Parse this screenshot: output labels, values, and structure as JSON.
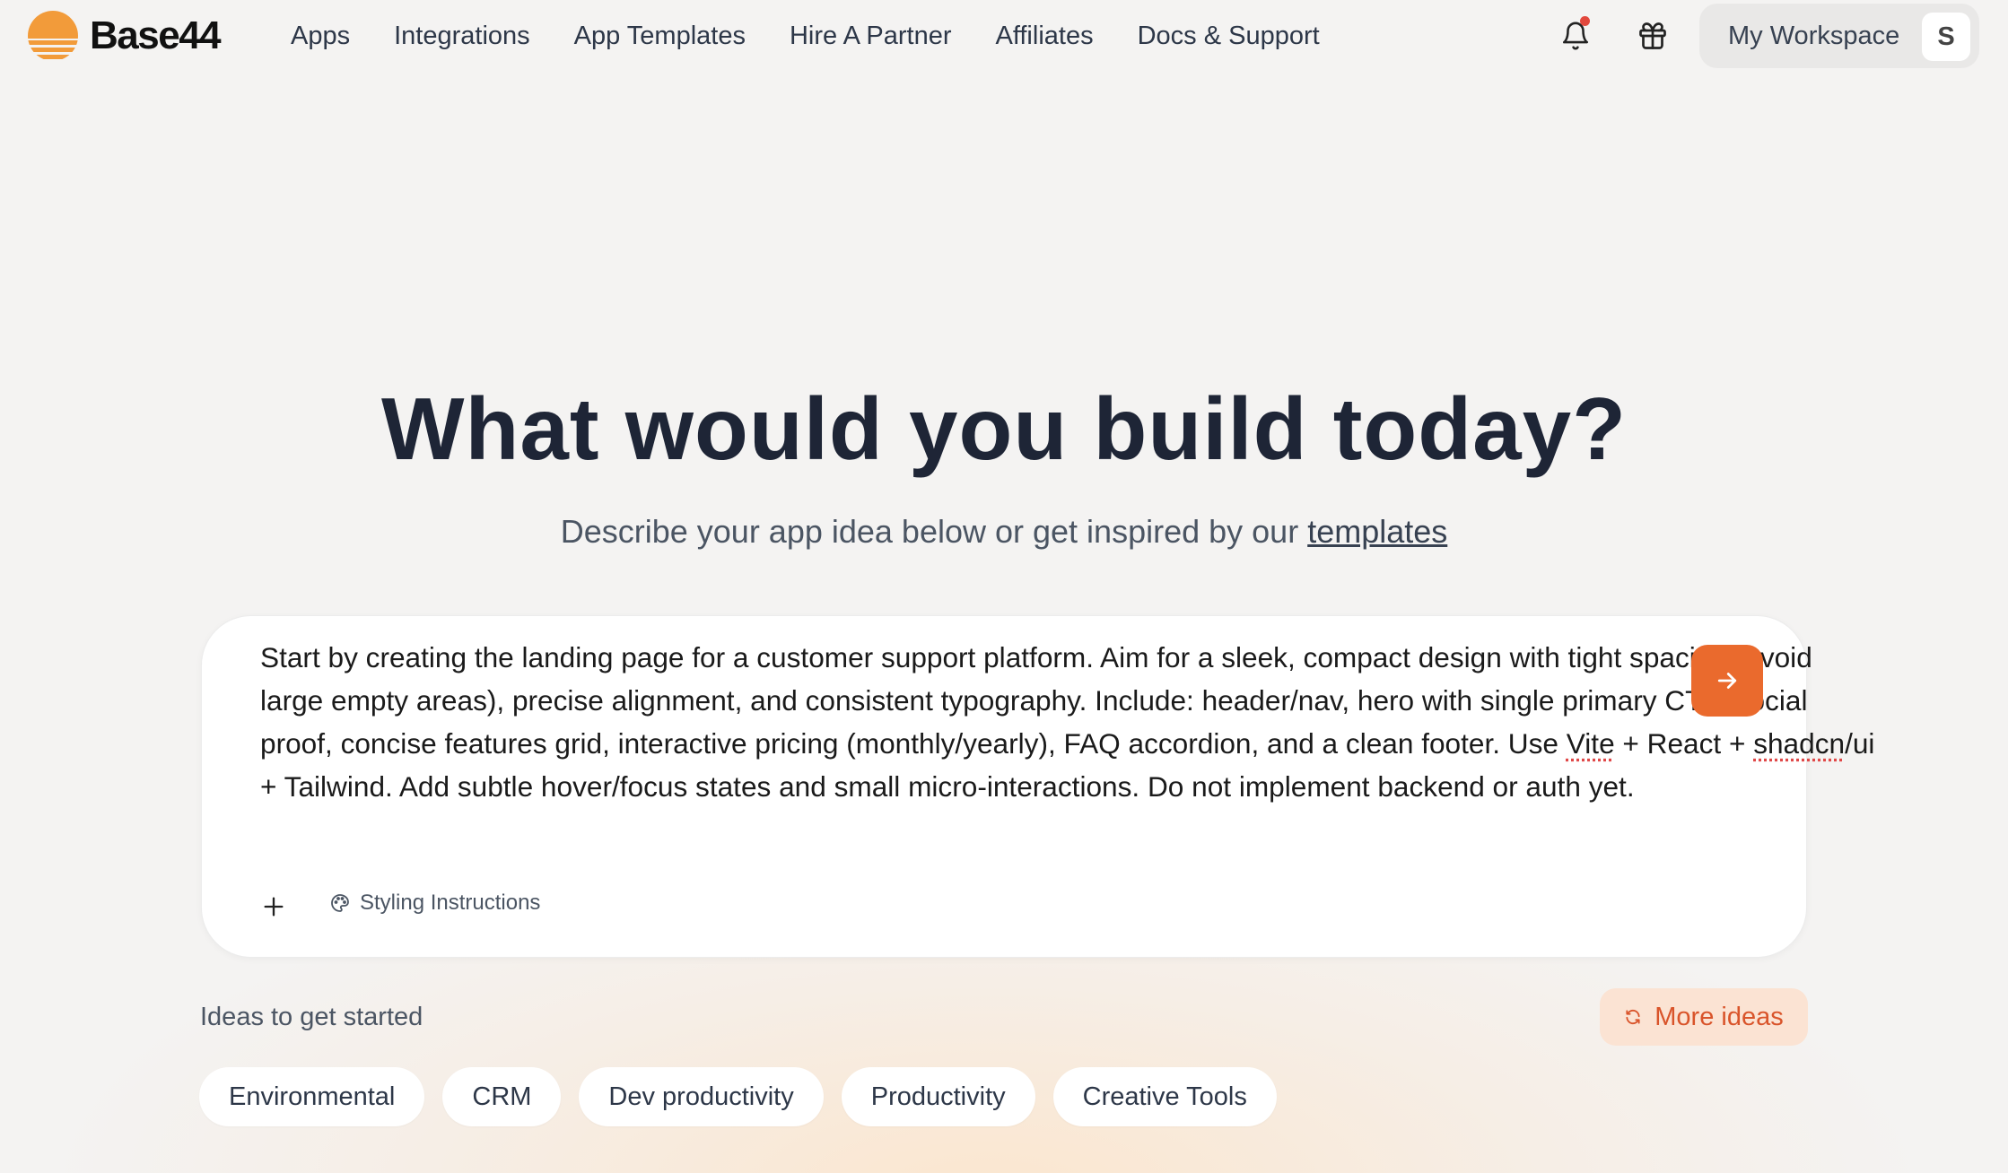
{
  "brand": {
    "name": "Base44",
    "accent": "#ea6a2d",
    "logo_color": "#f29b3a"
  },
  "nav": {
    "items": [
      {
        "label": "Apps"
      },
      {
        "label": "Integrations"
      },
      {
        "label": "App Templates"
      },
      {
        "label": "Hire A Partner"
      },
      {
        "label": "Affiliates"
      },
      {
        "label": "Docs & Support"
      }
    ]
  },
  "header": {
    "bell_icon": "bell-icon",
    "has_notification": true,
    "gift_icon": "gift-icon",
    "workspace_label": "My Workspace",
    "avatar_initial": "S"
  },
  "hero": {
    "title": "What would you build today?",
    "subtitle_prefix": "Describe your app idea below or get inspired by our ",
    "subtitle_link": "templates"
  },
  "prompt": {
    "text_1": "Start by creating the landing page for a customer support platform. Aim for a sleek, compact design with tight spacing (avoid large empty areas), precise alignment, and consistent typography. Include: header/nav, hero with single primary CTA, social proof, concise features grid, interactive pricing (monthly/yearly), FAQ accordion, and a clean footer. Use ",
    "word_vite": "Vite",
    "text_2": " + React + ",
    "word_shadcn": "shadcn",
    "text_3": "/ui + Tailwind. Add subtle hover/focus states and small micro-interactions. Do not implement backend or auth yet.",
    "send_icon": "arrow-right-icon",
    "attach_icon": "plus-icon",
    "styling_label": "Styling Instructions",
    "styling_icon": "palette-icon"
  },
  "ideas": {
    "label": "Ideas to get started",
    "more_label": "More ideas",
    "more_icon": "refresh-icon",
    "chips": [
      {
        "label": "Environmental"
      },
      {
        "label": "CRM"
      },
      {
        "label": "Dev productivity"
      },
      {
        "label": "Productivity"
      },
      {
        "label": "Creative Tools"
      }
    ]
  }
}
